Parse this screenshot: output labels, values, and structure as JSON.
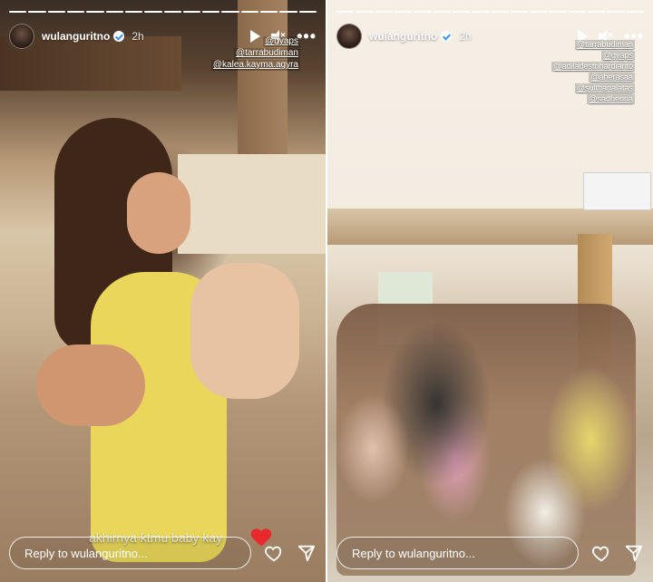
{
  "stories": [
    {
      "username": "wulanguritno",
      "time": "2h",
      "tags": [
        "@gyaps",
        "@tarrabudiman",
        "@kalea.kayma.agyra"
      ],
      "caption": "akhirnya ktmu baby kay",
      "reply_placeholder": "Reply to wulanguritno...",
      "segments_filled": 0,
      "segments_total": 16
    },
    {
      "username": "wulanguritno",
      "time": "2h",
      "tags": [
        "@tarrabudiman",
        "@gyaps",
        "@adiladestrihardianto",
        "@aherasaa",
        "@sulthanalatas",
        "@sadhenna"
      ],
      "reply_placeholder": "Reply to wulanguritno...",
      "segments_filled": 0,
      "segments_total": 16
    }
  ],
  "icons": {
    "play": "play-icon",
    "mute": "mute-icon",
    "more": "more-icon",
    "heart": "heart-icon",
    "send": "send-icon",
    "verified": "verified-badge-icon"
  },
  "colors": {
    "sticker_heart": "#e8282c",
    "verified": "#3897f0"
  }
}
